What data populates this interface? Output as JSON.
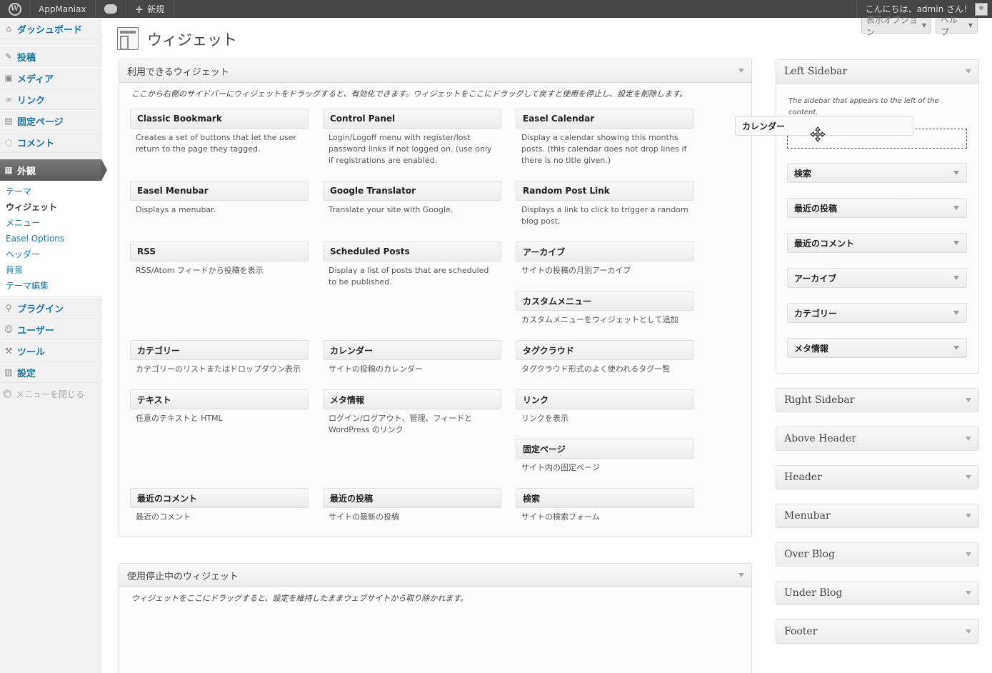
{
  "adminbar": {
    "site_name": "AppManiax",
    "new_label": "新規",
    "greeting": "こんにちは、admin さん！"
  },
  "menu": {
    "items": [
      {
        "label": "ダッシュボード",
        "icon": "home-icon"
      },
      {
        "label": "投稿",
        "icon": "pin-icon"
      },
      {
        "label": "メディア",
        "icon": "media-icon"
      },
      {
        "label": "リンク",
        "icon": "link-icon"
      },
      {
        "label": "固定ページ",
        "icon": "page-icon"
      },
      {
        "label": "コメント",
        "icon": "comment-icon"
      },
      {
        "label": "外観",
        "icon": "appearance-icon"
      },
      {
        "label": "プラグイン",
        "icon": "plugin-icon"
      },
      {
        "label": "ユーザー",
        "icon": "users-icon"
      },
      {
        "label": "ツール",
        "icon": "tools-icon"
      },
      {
        "label": "設定",
        "icon": "settings-icon"
      }
    ],
    "submenu": [
      "テーマ",
      "ウィジェット",
      "メニュー",
      "Easel Options",
      "ヘッダー",
      "背景",
      "テーマ編集"
    ],
    "collapse_label": "メニューを閉じる"
  },
  "screen_options": {
    "display_label": "表示オプション",
    "help_label": "ヘルプ"
  },
  "page_title": "ウィジェット",
  "available": {
    "title": "利用できるウィジェット",
    "description": "ここから右側のサイドバーにウィジェットをドラッグすると、有効化できます。ウィジェットをここにドラッグして戻すと使用を停止し、設定を削除します。",
    "widgets": [
      {
        "title": "Classic Bookmark",
        "desc": "Creates a set of buttons that let the user return to the page they tagged."
      },
      {
        "title": "Control Panel",
        "desc": "Login/Logoff menu with register/lost password links if not logged on. (use only if registrations are enabled."
      },
      {
        "title": "Easel Calendar",
        "desc": "Display a calendar showing this months posts. (this calendar does not drop lines if there is no title given.)"
      },
      {
        "title": "Easel Menubar",
        "desc": "Displays a menubar."
      },
      {
        "title": "Google Translator",
        "desc": "Translate your site with Google."
      },
      {
        "title": "Random Post Link",
        "desc": "Displays a link to click to trigger a random blog post."
      },
      {
        "title": "RSS",
        "desc": "RSS/Atom フィードから投稿を表示"
      },
      {
        "title": "Scheduled Posts",
        "desc": "Display a list of posts that are scheduled to be published."
      },
      {
        "title": "アーカイブ",
        "desc": "サイトの投稿の月別アーカイブ"
      },
      {
        "title": "カスタムメニュー",
        "desc": "カスタムメニューをウィジェットとして追加"
      },
      {
        "title": "カテゴリー",
        "desc": "カテゴリーのリストまたはドロップダウン表示"
      },
      {
        "title": "カレンダー",
        "desc": "サイトの投稿のカレンダー"
      },
      {
        "title": "タグクラウド",
        "desc": "タグクラウド形式のよく使われるタグ一覧"
      },
      {
        "title": "テキスト",
        "desc": "任意のテキストと HTML"
      },
      {
        "title": "メタ情報",
        "desc": "ログイン/ログアウト、管理、フィードと WordPress のリンク"
      },
      {
        "title": "リンク",
        "desc": "リンクを表示"
      },
      {
        "title": "固定ページ",
        "desc": "サイト内の固定ページ"
      },
      {
        "title": "最近のコメント",
        "desc": "最近のコメント"
      },
      {
        "title": "最近の投稿",
        "desc": "サイトの最新の投稿"
      },
      {
        "title": "検索",
        "desc": "サイトの検索フォーム"
      }
    ]
  },
  "inactive": {
    "title": "使用停止中のウィジェット",
    "description": "ウィジェットをここにドラッグすると、設定を維持したままウェブサイトから取り除かれます。"
  },
  "left_sidebar": {
    "title": "Left Sidebar",
    "description": "The sidebar that appears to the left of the content.",
    "widgets": [
      "検索",
      "最近の投稿",
      "最近のコメント",
      "アーカイブ",
      "カテゴリー",
      "メタ情報"
    ]
  },
  "dragging_widget": "カレンダー",
  "other_sidebars": [
    "Right Sidebar",
    "Above Header",
    "Header",
    "Menubar",
    "Over Blog",
    "Under Blog",
    "Footer"
  ]
}
